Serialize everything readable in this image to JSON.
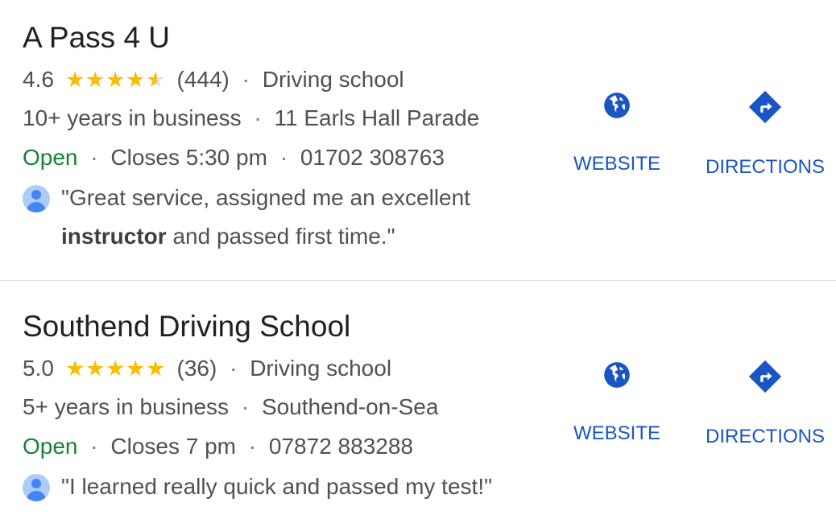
{
  "listings": [
    {
      "name": "A Pass 4 U",
      "rating": "4.6",
      "rating_value": 4.6,
      "review_count": "(444)",
      "category": "Driving school",
      "years": "10+ years in business",
      "address": "11 Earls Hall Parade",
      "status": "Open",
      "hours": "Closes 5:30 pm",
      "phone": "01702 308763",
      "review_part1": "\"Great service, assigned me an excellent ",
      "review_bold": "instructor",
      "review_part2": " and passed first time.\"",
      "website_label": "WEBSITE",
      "directions_label": "DIRECTIONS"
    },
    {
      "name": "Southend Driving School",
      "rating": "5.0",
      "rating_value": 5.0,
      "review_count": "(36)",
      "category": "Driving school",
      "years": "5+ years in business",
      "address": "Southend-on-Sea",
      "status": "Open",
      "hours": "Closes 7 pm",
      "phone": "07872 883288",
      "review_part1": "\"I learned really quick and passed my test!\"",
      "review_bold": "",
      "review_part2": "",
      "website_label": "WEBSITE",
      "directions_label": "DIRECTIONS"
    }
  ],
  "separator": "·",
  "icons": {
    "website": "globe-icon",
    "directions": "directions-icon",
    "avatar": "user-avatar-icon",
    "star": "star-icon"
  },
  "colors": {
    "star": "#fbbc04",
    "open": "#188038",
    "action": "#1a55c4"
  }
}
